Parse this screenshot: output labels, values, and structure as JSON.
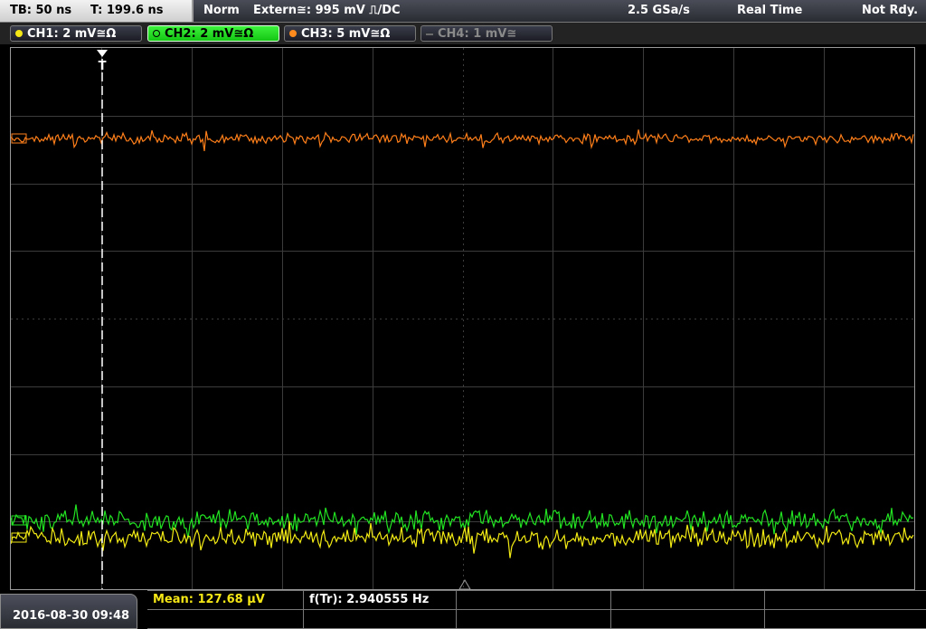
{
  "status": {
    "timebase": "TB: 50 ns",
    "trigger_time": "T: 199.6 ns",
    "trigger_mode": "Norm",
    "trigger_source": "Extern≅: 995 mV ⎍/DC",
    "sample_rate": "2.5 GSa/s",
    "acquisition_mode": "Real Time",
    "ready_state": "Not Rdy."
  },
  "channels": [
    {
      "label": "CH1: 2 mV≅Ω",
      "color": "#f5e616",
      "state": "on"
    },
    {
      "label": "CH2: 2 mV≅Ω",
      "color": "#28e028",
      "state": "selected"
    },
    {
      "label": "CH3: 5 mV≅Ω",
      "color": "#ff8a1e",
      "state": "on"
    },
    {
      "label": "CH4: 1 mV≅",
      "color": "#6a6a6a",
      "state": "off"
    }
  ],
  "trigger_marker": "T",
  "measurements": {
    "mean": "Mean: 127.68 µV",
    "frequency": "f(Tr): 2.940555 Hz"
  },
  "datetime": "2016-08-30 09:48",
  "colors": {
    "ch1_trace": "#f2ea14",
    "ch2_trace": "#22e322",
    "ch3_trace": "#ff7f1a",
    "grid": "#3c3c3c",
    "mean_text": "#f5e616"
  }
}
